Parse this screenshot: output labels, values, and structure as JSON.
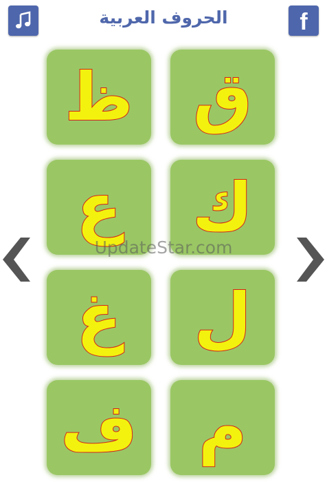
{
  "header": {
    "title": "الحروف العربية",
    "music_icon": "music-note-icon",
    "facebook_icon": "facebook-icon",
    "facebook_glyph": "f"
  },
  "tiles": [
    {
      "letter": "ظ"
    },
    {
      "letter": "ق"
    },
    {
      "letter": "ع"
    },
    {
      "letter": "ك"
    },
    {
      "letter": "غ"
    },
    {
      "letter": "ل"
    },
    {
      "letter": "ف"
    },
    {
      "letter": "م"
    }
  ],
  "navigation": {
    "prev_icon": "chevron-left-icon",
    "next_icon": "chevron-right-icon"
  },
  "watermark": "UpdateStar.com",
  "colors": {
    "header_blue": "#4e66ac",
    "tile_green": "#9ac764",
    "letter_fill": "#f2f20e",
    "letter_outline": "#d3211a",
    "arrow_gray": "#555555"
  }
}
